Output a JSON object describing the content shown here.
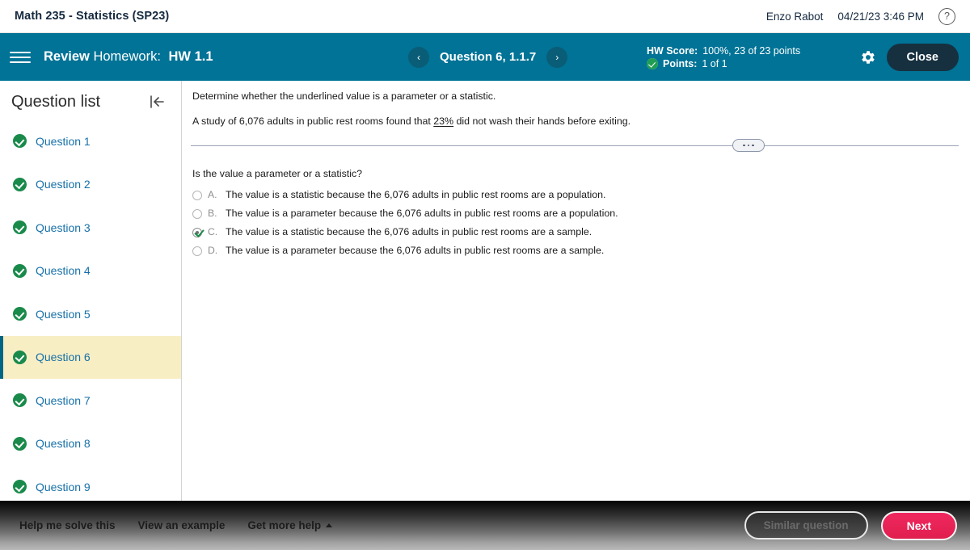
{
  "course_bar": {
    "title": "Math 235 - Statistics (SP23)",
    "user_name": "Enzo Rabot",
    "datetime": "04/21/23 3:46 PM",
    "help_glyph": "?"
  },
  "header": {
    "menu_icon": "hamburger-icon",
    "title_prefix": "Review",
    "title_label": "Homework:",
    "title_code": "HW 1.1",
    "prev_glyph": "‹",
    "next_glyph": "›",
    "question_label": "Question 6, 1.1.7",
    "score_key": "HW Score:",
    "score_value": "100%, 23 of 23 points",
    "points_key": "Points:",
    "points_value": "1 of 1",
    "settings_icon": "gear-icon",
    "close_label": "Close",
    "accent_teal": "#007396",
    "close_bg": "#16303f"
  },
  "sidebar": {
    "title": "Question list",
    "collapse_icon": "collapse-left-icon",
    "selected_index": 5,
    "highlight_bg": "#f8eec4",
    "highlight_border": "#006685",
    "link_color": "#1670a8",
    "check_color": "#1a8a4b",
    "items": [
      {
        "label": "Question 1",
        "status": "complete"
      },
      {
        "label": "Question 2",
        "status": "complete"
      },
      {
        "label": "Question 3",
        "status": "complete"
      },
      {
        "label": "Question 4",
        "status": "complete"
      },
      {
        "label": "Question 5",
        "status": "complete"
      },
      {
        "label": "Question 6",
        "status": "complete"
      },
      {
        "label": "Question 7",
        "status": "complete"
      },
      {
        "label": "Question 8",
        "status": "complete"
      },
      {
        "label": "Question 9",
        "status": "complete"
      }
    ]
  },
  "question": {
    "instruction": "Determine whether the underlined value is a parameter or a statistic.",
    "body_before": "A study of 6,076 adults in public rest rooms found that ",
    "body_underlined": "23%",
    "body_after": " did not wash their hands before exiting.",
    "prompt": "Is the value a parameter or a statistic?",
    "selected_choice": "C",
    "choices": [
      {
        "letter": "A.",
        "text": "The value is a statistic because the 6,076 adults in public rest rooms are a population.",
        "selected": false
      },
      {
        "letter": "B.",
        "text": "The value is a parameter because the 6,076 adults in public rest rooms are a population.",
        "selected": false
      },
      {
        "letter": "C.",
        "text": "The value is a statistic because the 6,076 adults in public rest rooms are a sample.",
        "selected": true
      },
      {
        "letter": "D.",
        "text": "The value is a parameter because the 6,076 adults in public rest rooms are a sample.",
        "selected": false
      }
    ]
  },
  "footer": {
    "help_me_solve": "Help me solve this",
    "view_example": "View an example",
    "get_more_help": "Get more help",
    "get_more_help_caret": "caret-up-icon",
    "similar_question": "Similar question",
    "next": "Next",
    "next_bg": "#e01f4e"
  }
}
